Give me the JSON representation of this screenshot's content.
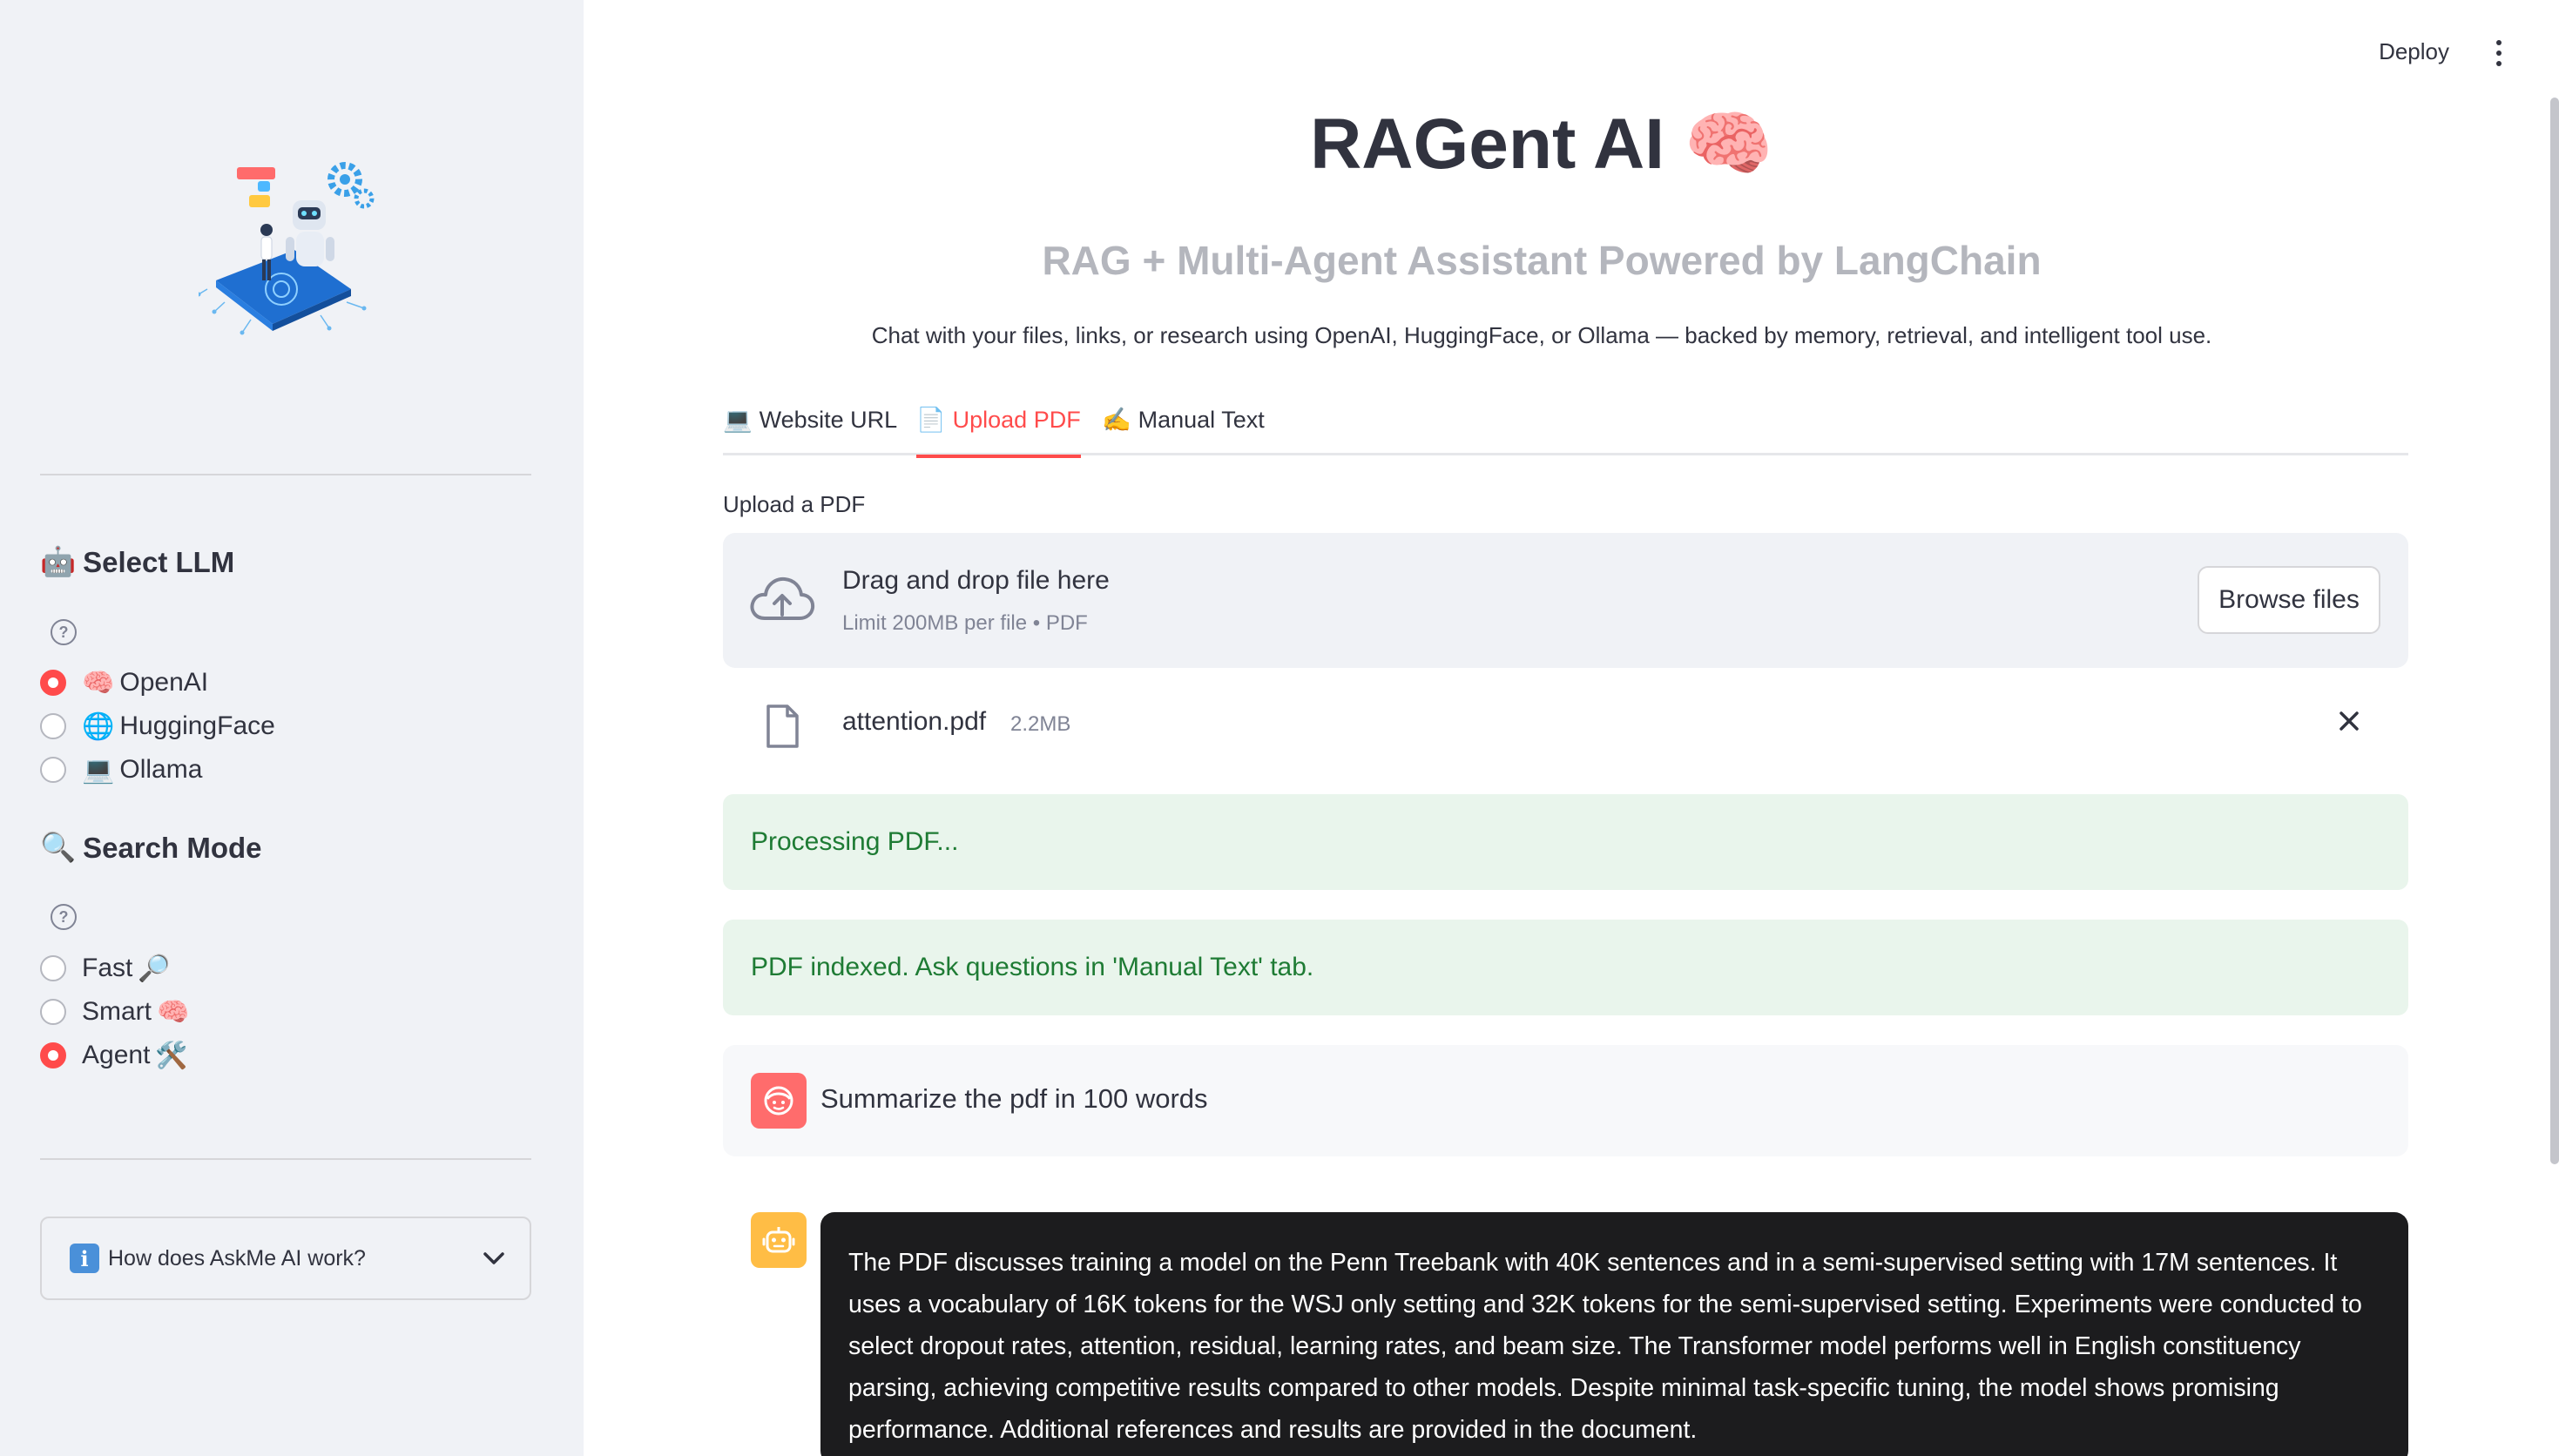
{
  "header": {
    "deploy_label": "Deploy",
    "menu_icon": "more-vertical-icon"
  },
  "sidebar": {
    "logo_icon": "ai-robot-illustration",
    "select_llm": {
      "heading": "Select LLM",
      "heading_emoji": "🤖",
      "options": [
        {
          "emoji": "🧠",
          "label": "OpenAI",
          "selected": true
        },
        {
          "emoji": "🌐",
          "label": "HuggingFace",
          "selected": false
        },
        {
          "emoji": "💻",
          "label": "Ollama",
          "selected": false
        }
      ]
    },
    "search_mode": {
      "heading": "Search Mode",
      "heading_emoji": "🔍",
      "options": [
        {
          "label": "Fast",
          "emoji": "🔎",
          "selected": false
        },
        {
          "label": "Smart",
          "emoji": "🧠",
          "selected": false
        },
        {
          "label": "Agent",
          "emoji": "🛠️",
          "selected": true
        }
      ]
    },
    "expander": {
      "emoji": "i",
      "label": "How does AskMe AI work?"
    }
  },
  "main": {
    "title": "RAGent AI",
    "title_emoji": "🧠",
    "subtitle": "RAG + Multi-Agent Assistant Powered by LangChain",
    "tagline": "Chat with your files, links, or research using OpenAI, HuggingFace, or Ollama — backed by memory, retrieval, and intelligent tool use.",
    "tabs": [
      {
        "emoji": "💻",
        "label": "Website URL",
        "active": false
      },
      {
        "emoji": "📄",
        "label": "Upload PDF",
        "active": true
      },
      {
        "emoji": "✍️",
        "label": "Manual Text",
        "active": false
      }
    ],
    "uploader": {
      "label": "Upload a PDF",
      "drop_title": "Drag and drop file here",
      "drop_subtitle": "Limit 200MB per file • PDF",
      "browse_label": "Browse files"
    },
    "file": {
      "name": "attention.pdf",
      "size": "2.2MB"
    },
    "alerts": [
      "Processing PDF...",
      "PDF indexed. Ask questions in 'Manual Text' tab."
    ],
    "chat": {
      "user_message": "Summarize the pdf in 100 words",
      "bot_message": "The PDF discusses training a model on the Penn Treebank with 40K sentences and in a semi-supervised setting with 17M sentences. It uses a vocabulary of 16K tokens for the WSJ only setting and 32K tokens for the semi-supervised setting. Experiments were conducted to select dropout rates, attention, residual, learning rates, and beam size. The Transformer model performs well in English constituency parsing, achieving competitive results compared to other models. Despite minimal task-specific tuning, the model shows promising performance. Additional references and results are provided in the document."
    }
  },
  "colors": {
    "accent": "#ff4b4b",
    "sidebar_bg": "#f0f2f6",
    "success_bg": "#e9f5ec",
    "success_text": "#1e7b34",
    "bot_bubble": "#1c1c1e"
  }
}
